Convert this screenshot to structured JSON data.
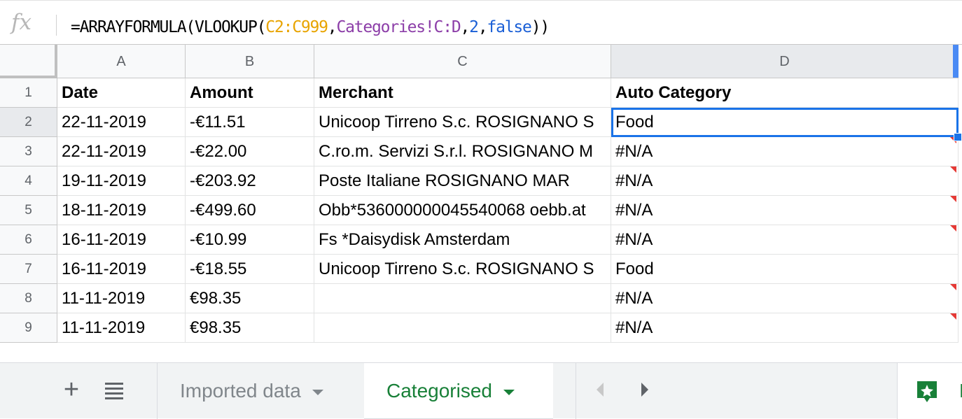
{
  "formula_bar": {
    "fx_label": "fx",
    "formula_parts": [
      {
        "text": "=ARRAYFORMULA(VLOOKUP(",
        "kind": "plain"
      },
      {
        "text": "C2:C999",
        "kind": "range"
      },
      {
        "text": ",",
        "kind": "plain"
      },
      {
        "text": "Categories!C:D",
        "kind": "sheet"
      },
      {
        "text": ",",
        "kind": "plain"
      },
      {
        "text": "2",
        "kind": "num"
      },
      {
        "text": ",",
        "kind": "plain"
      },
      {
        "text": "false",
        "kind": "bool"
      },
      {
        "text": "))",
        "kind": "plain"
      }
    ]
  },
  "grid": {
    "columns": [
      "A",
      "B",
      "C",
      "D"
    ],
    "active_column": "D",
    "active_row": "2",
    "rows": [
      {
        "num": "1",
        "cells": [
          "Date",
          "Amount",
          "Merchant",
          "Auto Category"
        ],
        "header": true
      },
      {
        "num": "2",
        "cells": [
          "22-11-2019",
          "-€11.51",
          "Unicoop Tirreno S.c. ROSIGNANO S",
          "Food"
        ]
      },
      {
        "num": "3",
        "cells": [
          "22-11-2019",
          "-€22.00",
          "C.ro.m. Servizi S.r.l. ROSIGNANO M",
          "#N/A"
        ],
        "error": true
      },
      {
        "num": "4",
        "cells": [
          "19-11-2019",
          "-€203.92",
          "Poste Italiane ROSIGNANO MAR",
          "#N/A"
        ],
        "error": true
      },
      {
        "num": "5",
        "cells": [
          "18-11-2019",
          "-€499.60",
          "Obb*536000000045540068 oebb.at",
          "#N/A"
        ],
        "error": true
      },
      {
        "num": "6",
        "cells": [
          "16-11-2019",
          "-€10.99",
          "Fs *Daisydisk Amsterdam",
          "#N/A"
        ],
        "error": true
      },
      {
        "num": "7",
        "cells": [
          "16-11-2019",
          "-€18.55",
          "Unicoop Tirreno S.c. ROSIGNANO S",
          "Food"
        ]
      },
      {
        "num": "8",
        "cells": [
          "11-11-2019",
          "€98.35",
          "",
          "#N/A"
        ],
        "error": true
      },
      {
        "num": "9",
        "cells": [
          "11-11-2019",
          "€98.35",
          "",
          "#N/A"
        ],
        "error": true
      }
    ]
  },
  "tabs": {
    "add_icon": "+",
    "items": [
      {
        "label": "Imported data",
        "active": false
      },
      {
        "label": "Categorised",
        "active": true
      }
    ],
    "explore_label": "E"
  },
  "colors": {
    "active_tab": "#188038",
    "selection": "#1a73e8",
    "error_marker": "#e53935",
    "range_token": "#e8a400",
    "sheet_token": "#8c3ea8",
    "number_token": "#1a5fd6"
  }
}
